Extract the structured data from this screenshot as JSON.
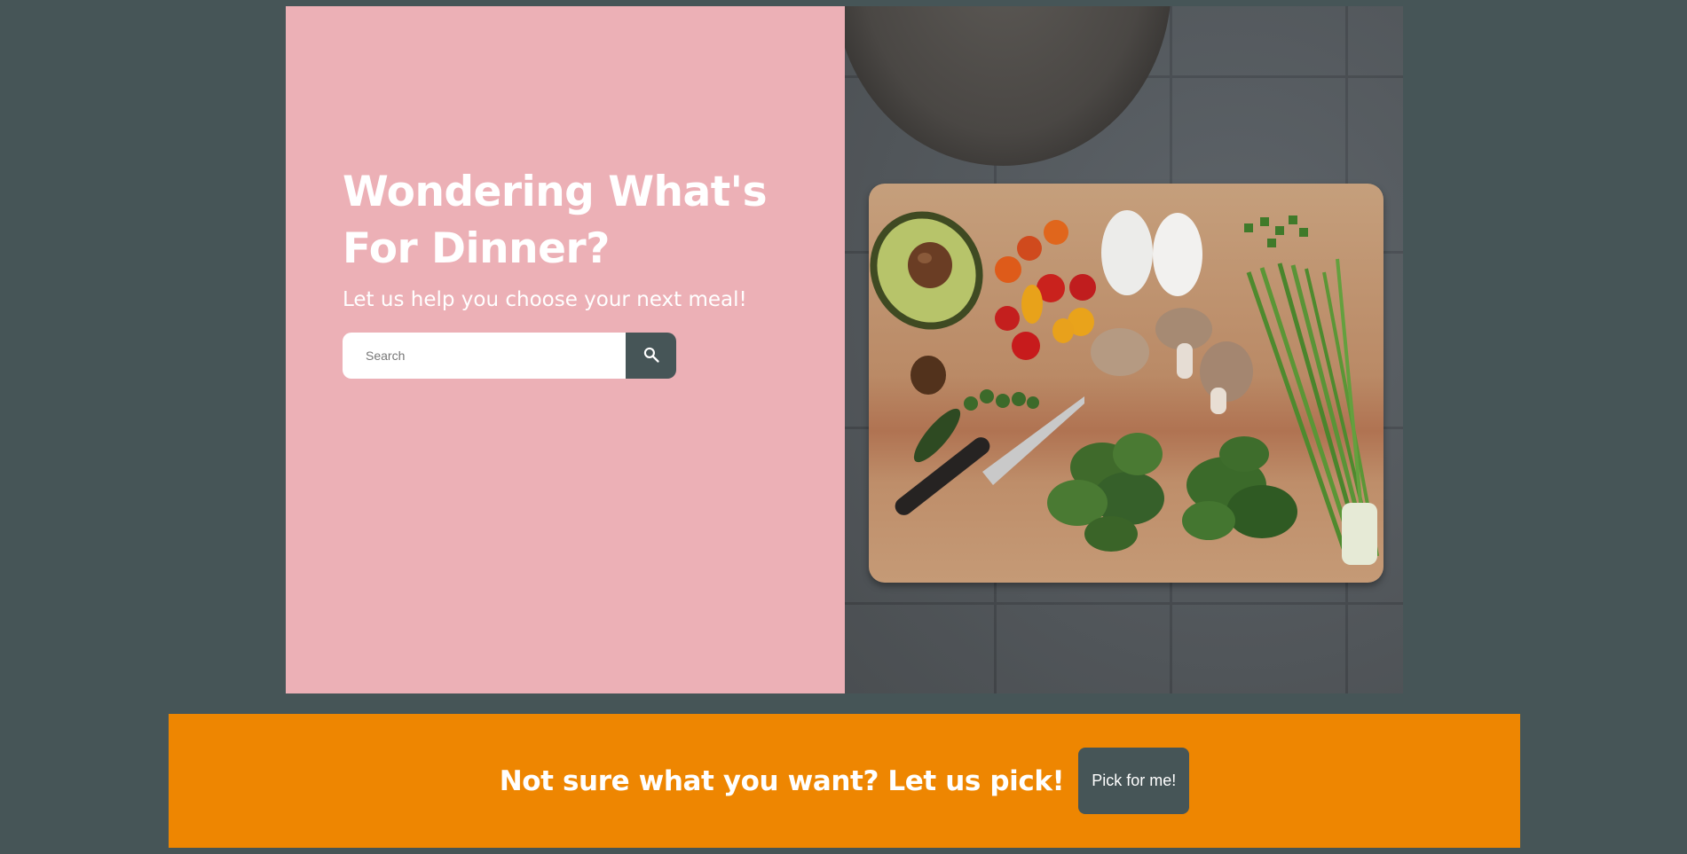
{
  "hero": {
    "headline_line1": "Wondering What's",
    "headline_line2": "For Dinner?",
    "subheadline": "Let us help you choose your next meal!",
    "search": {
      "placeholder": "Search",
      "value": "",
      "button_icon": "search-icon"
    },
    "image": {
      "subject": "cutting board with avocado, tomatoes, eggs, mushrooms, spinach, scallions, knife and frying pan on tile floor",
      "icon": "food-photo"
    },
    "colors": {
      "left_panel": "#ecb0b6",
      "page_background": "#465557"
    }
  },
  "cta": {
    "text": "Not sure what you want? Let us pick!",
    "button_label": "Pick for me!",
    "background": "#ee8601",
    "button_background": "#465557"
  }
}
